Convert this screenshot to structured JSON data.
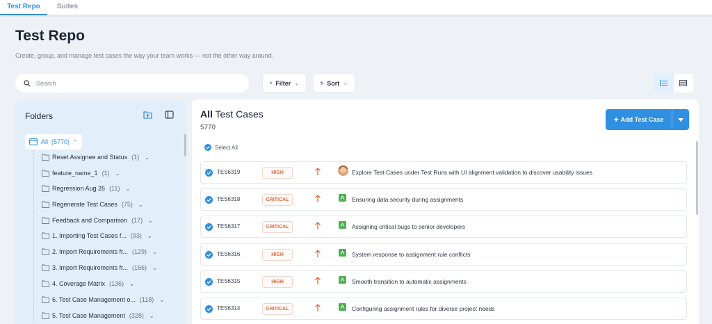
{
  "tabs": [
    {
      "label": "Test Repo",
      "active": true
    },
    {
      "label": "Suites",
      "active": false
    }
  ],
  "page": {
    "title": "Test Repo",
    "subtitle": "Create, group, and manage test cases the way your team works — not the other way around."
  },
  "search": {
    "placeholder": "Search",
    "value": ""
  },
  "toolbar": {
    "filter_label": "Filter",
    "sort_label": "Sort"
  },
  "folders": {
    "title": "Folders",
    "all": {
      "label": "All",
      "count": "(5770)"
    },
    "items": [
      {
        "label": "Reset Assignee and Status",
        "count": "(1)"
      },
      {
        "label": "feature_name_1",
        "count": "(1)"
      },
      {
        "label": "Regression Aug 26",
        "count": "(11)"
      },
      {
        "label": "Regenerate Test Cases",
        "count": "(75)"
      },
      {
        "label": "Feedback and Comparison",
        "count": "(17)"
      },
      {
        "label": "1. Importing Test Cases f...",
        "count": "(93)"
      },
      {
        "label": "2. Import Requirements fr...",
        "count": "(129)"
      },
      {
        "label": "3. Import Requirements fr...",
        "count": "(166)"
      },
      {
        "label": "4. Coverage Matrix",
        "count": "(136)"
      },
      {
        "label": "6. Test Case Management o...",
        "count": "(118)"
      },
      {
        "label": "5. Test Case Management",
        "count": "(328)"
      }
    ]
  },
  "main": {
    "title_bold": "All",
    "title_rest": " Test Cases",
    "count": "5770",
    "add_button": "Add Test Case",
    "select_all": "Select All",
    "cases": [
      {
        "id": "TES6319",
        "priority": "HIGH",
        "title": "Explore Test Cases under Test Runs with UI alignment validation to discover usability issues",
        "icon": "avatar"
      },
      {
        "id": "TES6318",
        "priority": "CRITICAL",
        "title": "Ensuring data security during assignments",
        "icon": "ai-generated-icon"
      },
      {
        "id": "TES6317",
        "priority": "CRITICAL",
        "title": "Assigning critical bugs to senior developers",
        "icon": "ai-generated-icon"
      },
      {
        "id": "TES6316",
        "priority": "HIGH",
        "title": "System response to assignment rule conflicts",
        "icon": "ai-generated-icon"
      },
      {
        "id": "TES6315",
        "priority": "HIGH",
        "title": "Smooth transition to automatic assignments",
        "icon": "ai-generated-icon"
      },
      {
        "id": "TES6314",
        "priority": "CRITICAL",
        "title": "Configuring assignment rules for diverse project needs",
        "icon": "ai-generated-icon"
      }
    ]
  },
  "colors": {
    "accent": "#2f8fe0",
    "priority_text": "#e0683a",
    "ai_icon": "#4caf50",
    "folder_panel": "#e2eefa"
  }
}
